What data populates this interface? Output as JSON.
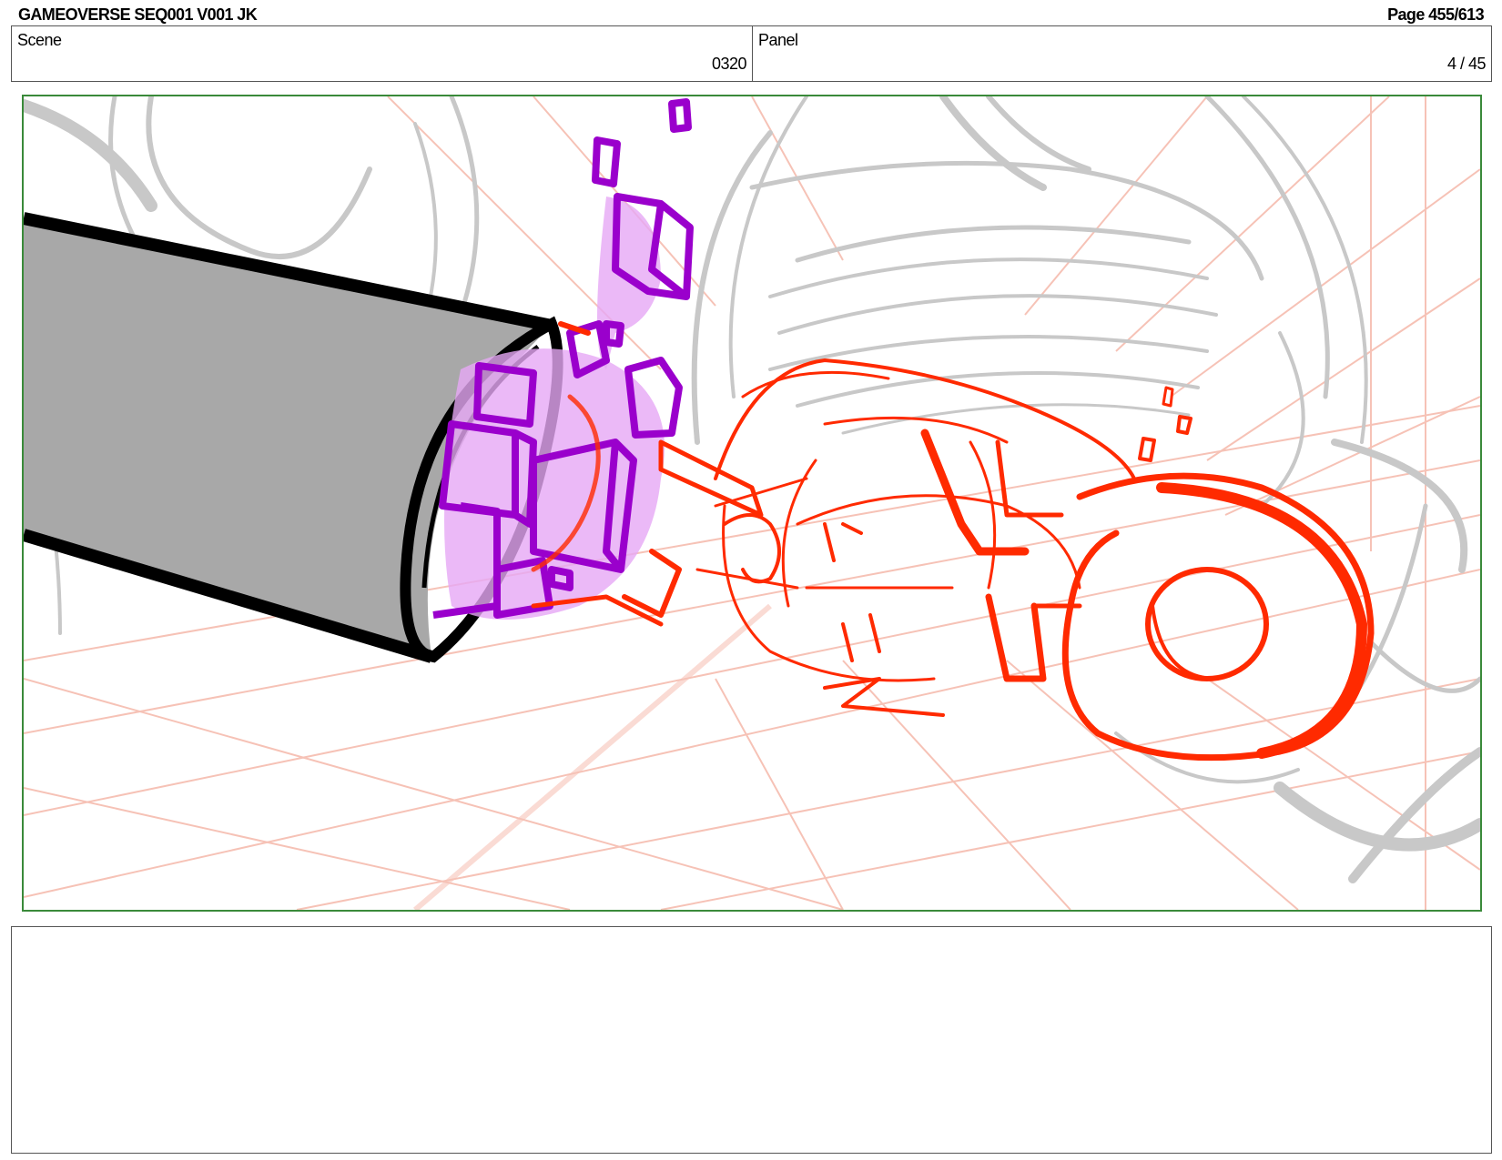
{
  "header": {
    "title": "GAMEOVERSE SEQ001 V001 JK",
    "page": "Page 455/613"
  },
  "scene": {
    "label": "Scene",
    "value": "0320"
  },
  "panel": {
    "label": "Panel",
    "value": "4 / 45"
  },
  "colors": {
    "frame_border": "#3a8a3a",
    "sketch_red": "#ff2a00",
    "effect_purple": "#9a00cc",
    "effect_fill": "#e6a8f5",
    "background_lines": "#c8c8c8",
    "grid_lines": "#f5b8aa",
    "barrel_fill": "#a8a8a8"
  },
  "notes": {
    "text": ""
  }
}
